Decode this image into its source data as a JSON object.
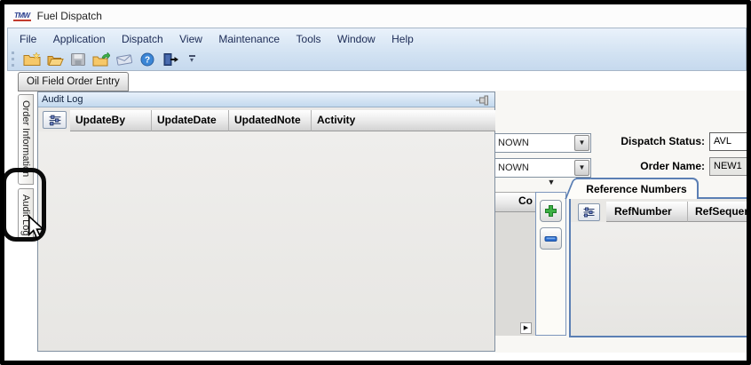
{
  "window": {
    "title": "Fuel Dispatch",
    "logo_text": "TMW"
  },
  "menu": {
    "items": [
      "File",
      "Application",
      "Dispatch",
      "View",
      "Maintenance",
      "Tools",
      "Window",
      "Help"
    ]
  },
  "toolbar": {
    "icons": [
      "new-folder-icon",
      "open-folder-icon",
      "save-disk-icon",
      "folder-import-icon",
      "envelope-icon",
      "help-icon",
      "exit-door-icon",
      "toolbar-overflow-icon"
    ]
  },
  "tab_bar": {
    "active_tab": "Oil Field Order Entry"
  },
  "side_tabs": {
    "order_information": "Order Information",
    "audit_log": "Audit Log"
  },
  "audit_panel": {
    "title": "Audit Log",
    "columns": [
      "UpdateBy",
      "UpdateDate",
      "UpdatedNote",
      "Activity"
    ],
    "rows": [],
    "icons": [
      "column-chooser-icon",
      "pin-icon"
    ]
  },
  "order_form": {
    "combo1_visible_value": "NOWN",
    "combo2_visible_value": "NOWN",
    "dispatch_status_label": "Dispatch Status:",
    "dispatch_status_value": "AVL",
    "order_name_label": "Order Name:",
    "order_name_value": "NEW1",
    "clipped_column_header": "Co",
    "dropdown_glyph": "▼",
    "scroll_arrow_glyph": "▶"
  },
  "reference_panel": {
    "tab_label": "Reference Numbers",
    "columns": [
      "RefNumber",
      "RefSequence"
    ],
    "rows": [],
    "icons": [
      "column-chooser-icon",
      "add-icon",
      "remove-icon"
    ]
  },
  "colors": {
    "plus_green": "#3db044",
    "minus_blue": "#2e6fd0",
    "panel_border_blue": "#5b7fb4",
    "menu_text": "#1b2a55",
    "annotation_black": "#0a0a0a"
  }
}
